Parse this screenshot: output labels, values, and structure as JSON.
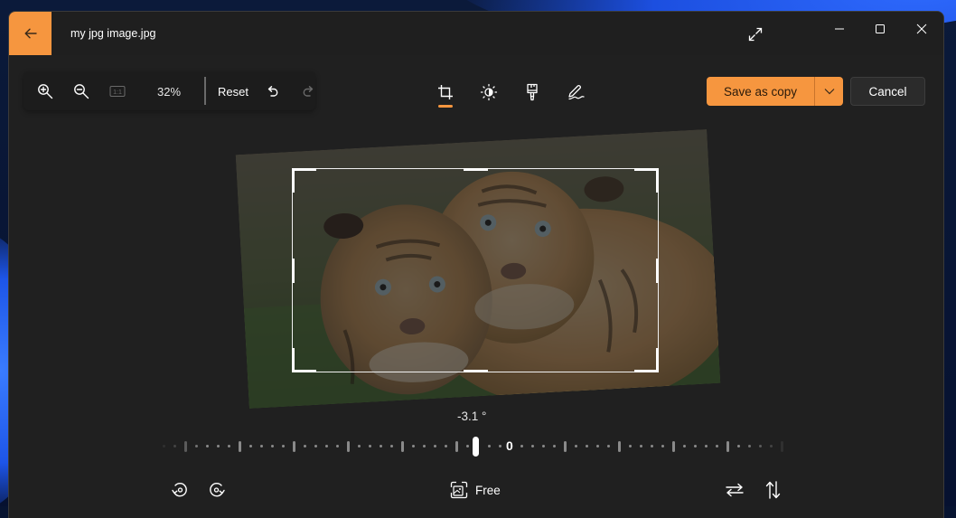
{
  "window": {
    "title": "my jpg image.jpg",
    "accent_color": "#f6963f"
  },
  "titlebar": {
    "back_icon": "arrow-left-icon",
    "expand_icon": "expand-diagonal-icon",
    "controls": [
      "minimize-icon",
      "maximize-icon",
      "close-icon"
    ]
  },
  "zoom_toolbar": {
    "zoom_in_icon": "zoom-in-icon",
    "zoom_out_icon": "zoom-out-icon",
    "actual_size_icon": "actual-size-1to1-icon",
    "actual_size_label": "1:1",
    "zoom_level": "32%",
    "reset_label": "Reset",
    "undo_icon": "undo-icon",
    "redo_icon": "redo-icon"
  },
  "edit_modes": {
    "active": "crop",
    "tabs": [
      {
        "id": "crop",
        "icon": "crop-icon"
      },
      {
        "id": "adjust",
        "icon": "brightness-icon"
      },
      {
        "id": "filter",
        "icon": "paintbrush-icon"
      },
      {
        "id": "markup",
        "icon": "pen-markup-icon"
      }
    ]
  },
  "actions": {
    "save_label": "Save as copy",
    "save_dropdown_icon": "chevron-down-icon",
    "cancel_label": "Cancel"
  },
  "straighten": {
    "angle_label": "-3.1 °",
    "angle_value": -3.1,
    "zero_label": "0"
  },
  "bottom_bar": {
    "rotate_left_icon": "rotate-left-icon",
    "rotate_right_icon": "rotate-right-icon",
    "aspect_icon": "aspect-ratio-icon",
    "aspect_label": "Free",
    "flip_horizontal_icon": "flip-horizontal-icon",
    "flip_vertical_icon": "flip-vertical-icon"
  },
  "image": {
    "subject": "two tiger cubs lying in grass"
  }
}
